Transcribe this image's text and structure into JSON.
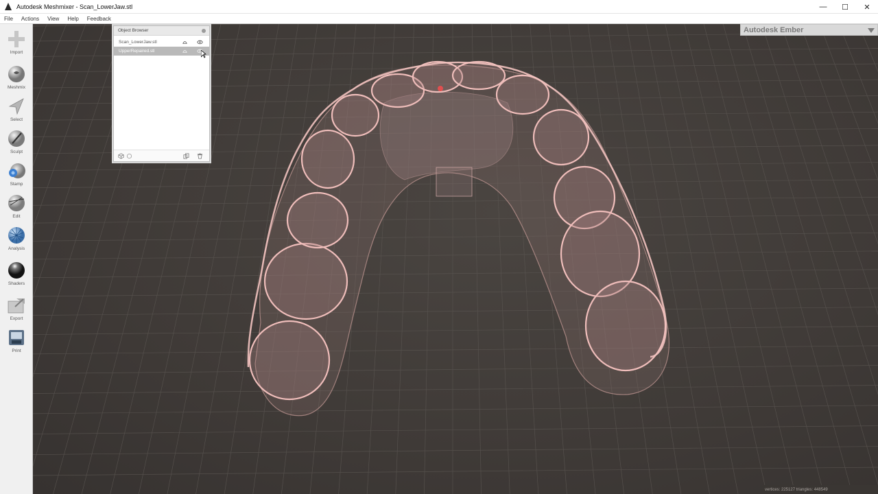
{
  "window": {
    "title": "Autodesk Meshmixer - Scan_LowerJaw.stl",
    "controls": {
      "minimize": "—",
      "maximize": "☐",
      "close": "✕"
    }
  },
  "menu": {
    "items": [
      "File",
      "Actions",
      "View",
      "Help",
      "Feedback"
    ]
  },
  "toolbar": {
    "tools": [
      {
        "label": "Import",
        "icon": "import-plus-icon"
      },
      {
        "label": "Meshmix",
        "icon": "meshmix-sphere-icon"
      },
      {
        "label": "Select",
        "icon": "select-arrow-icon"
      },
      {
        "label": "Sculpt",
        "icon": "sculpt-brush-icon"
      },
      {
        "label": "Stamp",
        "icon": "stamp-icon"
      },
      {
        "label": "Edit",
        "icon": "edit-sphere-icon"
      },
      {
        "label": "Analysis",
        "icon": "analysis-sphere-icon"
      },
      {
        "label": "Shaders",
        "icon": "shaders-sphere-icon"
      },
      {
        "label": "Export",
        "icon": "export-folder-icon"
      },
      {
        "label": "Print",
        "icon": "print-icon"
      }
    ]
  },
  "object_browser": {
    "title": "Object Browser",
    "objects": [
      {
        "name": "Scan_LowerJaw.stl",
        "selected": false
      },
      {
        "name": "UpperRepaired.stl",
        "selected": true
      }
    ]
  },
  "right_panel": {
    "title": "Autodesk Ember"
  },
  "status": {
    "text": "vertices: 225127 triangles: 448549"
  },
  "colors": {
    "viewport_bg": "#3f3a37",
    "grid": "#5a5551",
    "mesh_stroke": "#e6b3b0",
    "mesh_fill": "#9c7f7d",
    "marker": "#e05050"
  }
}
